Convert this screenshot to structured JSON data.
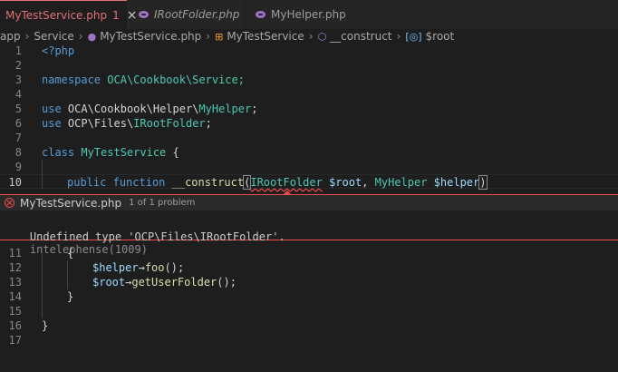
{
  "tabs": [
    {
      "label": "MyTestService.php",
      "badge": "1",
      "close": "×",
      "active": true
    },
    {
      "label": "IRootFolder.php",
      "active": false
    },
    {
      "label": "MyHelper.php",
      "active": false
    }
  ],
  "breadcrumb": [
    "app",
    "Service",
    "MyTestService.php",
    "MyTestService",
    "__construct",
    "$root"
  ],
  "code": {
    "line_numbers": [
      "1",
      "2",
      "3",
      "4",
      "5",
      "6",
      "7",
      "8",
      "9",
      "10",
      "11",
      "12",
      "13",
      "14",
      "15",
      "16",
      "17"
    ],
    "l1": "<?php",
    "l3_kw": "namespace",
    "l3_ns": "OCA\\Cookbook\\Service;",
    "l5_kw": "use",
    "l5_path": "OCA\\Cookbook\\Helper\\",
    "l5_cls": "MyHelper",
    "l5_end": ";",
    "l6_kw": "use",
    "l6_path": "OCP\\Files\\",
    "l6_cls": "IRootFolder",
    "l6_end": ";",
    "l8_kw": "class",
    "l8_cls": "MyTestService",
    "l8_end": " {",
    "l10_kw1": "public",
    "l10_kw2": "function",
    "l10_fn": "__construct",
    "l10_open": "(",
    "l10_type1": "IRootFolder",
    "l10_var1": "$root",
    "l10_comma": ",",
    "l10_type2": "MyHelper",
    "l10_var2": "$helper",
    "l10_close": ")",
    "l11": "{",
    "l12_var": "$helper",
    "l12_arrow": "→",
    "l12_fn": "foo",
    "l12_end": "();",
    "l13_var": "$root",
    "l13_arrow": "→",
    "l13_fn": "getUserFolder",
    "l13_end": "();",
    "l14": "}",
    "l16": "}"
  },
  "problem": {
    "file": "MyTestService.php",
    "count": "1 of 1 problem",
    "message": "Undefined type 'OCP\\Files\\IRootFolder'.",
    "source": "intelephense(1009)"
  },
  "colors": {
    "error": "#f14c4c",
    "accent_tab": "#e2707a"
  }
}
